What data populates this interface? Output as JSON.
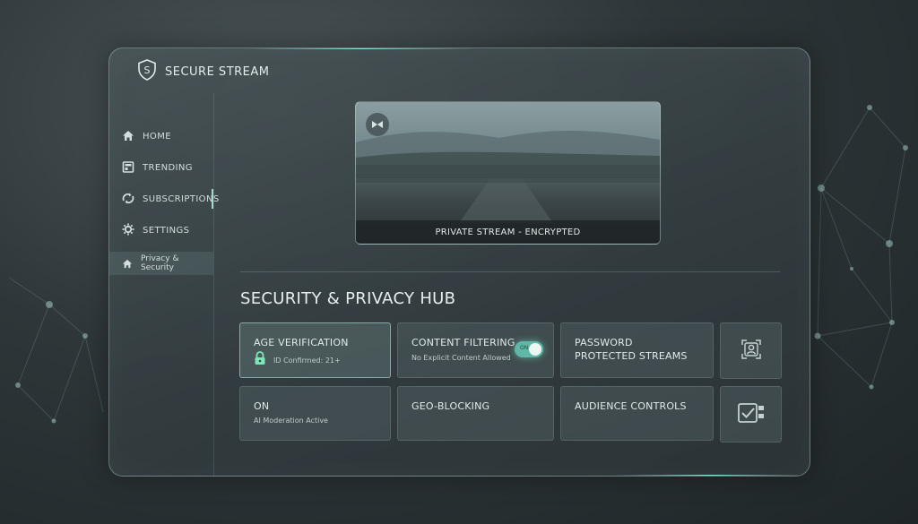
{
  "brand": {
    "title": "SECURE STREAM",
    "icon": "shield-s-icon"
  },
  "sidebar": {
    "items": [
      {
        "label": "HOME",
        "icon": "home-icon"
      },
      {
        "label": "TRENDING",
        "icon": "trending-icon"
      },
      {
        "label": "SUBSCRIPTIONS",
        "icon": "subscriptions-icon"
      },
      {
        "label": "SETTINGS",
        "icon": "gear-icon"
      },
      {
        "label": "Privacy & Security",
        "icon": "home-icon",
        "active": true
      }
    ]
  },
  "video": {
    "caption": "PRIVATE STREAM - ENCRYPTED"
  },
  "hub": {
    "title": "SECURITY & PRIVACY HUB",
    "age_verification": {
      "title": "AGE VERIFICATION",
      "subtitle": "ID Confirmed: 21+",
      "icon": "lock-icon"
    },
    "content_filtering": {
      "title": "CONTENT FILTERING",
      "subtitle": "No Explicit Content Allowed",
      "toggle_label": "ON",
      "toggle_on": true
    },
    "password_streams": {
      "title": "PASSWORD PROTECTED STREAMS"
    },
    "ai_moderation": {
      "title": "ON",
      "subtitle": "AI Moderation Active"
    },
    "geo_blocking": {
      "title": "GEO-BLOCKING"
    },
    "audience_controls": {
      "title": "AUDIENCE CONTROLS"
    }
  },
  "colors": {
    "accent": "#8fe3d5",
    "toggle": "#5fb8a7",
    "lock": "#7ee6b8"
  }
}
